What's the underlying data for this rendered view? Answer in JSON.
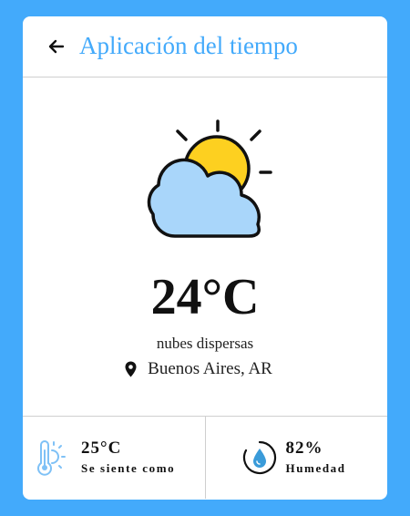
{
  "header": {
    "title": "Aplicación del tiempo",
    "back_icon": "arrow-left-icon"
  },
  "weather": {
    "icon": "partly-cloudy-icon",
    "temperature": "24°C",
    "description": "nubes dispersas",
    "location": "Buenos Aires, AR",
    "location_icon": "map-pin-icon"
  },
  "details": {
    "feels_like": {
      "value": "25°C",
      "label": "Se siente como",
      "icon": "thermometer-sun-icon"
    },
    "humidity": {
      "value": "82%",
      "label": "Humedad",
      "icon": "humidity-drop-icon"
    }
  },
  "colors": {
    "background": "#43aafb",
    "accent": "#43aafb",
    "sun": "#fdd020",
    "cloud": "#a9d6fa",
    "icon_blue": "#7fc1f6"
  }
}
